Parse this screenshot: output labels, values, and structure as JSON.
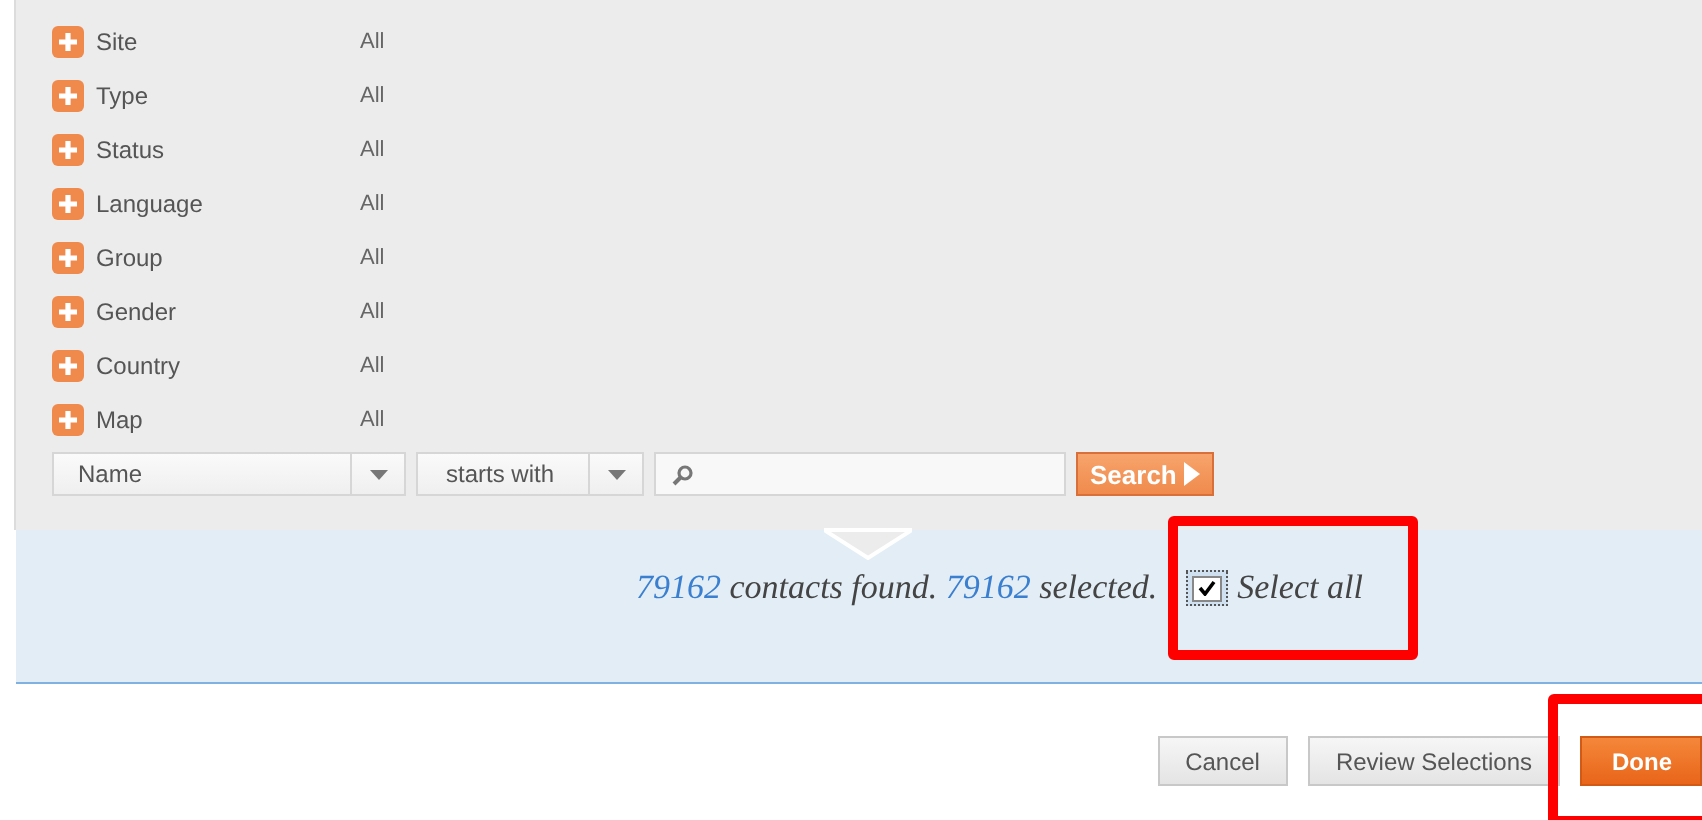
{
  "filters": [
    {
      "label": "Site",
      "value": "All"
    },
    {
      "label": "Type",
      "value": "All"
    },
    {
      "label": "Status",
      "value": "All"
    },
    {
      "label": "Language",
      "value": "All"
    },
    {
      "label": "Group",
      "value": "All"
    },
    {
      "label": "Gender",
      "value": "All"
    },
    {
      "label": "Country",
      "value": "All"
    },
    {
      "label": "Map",
      "value": "All"
    }
  ],
  "search_bar": {
    "field": "Name",
    "operator": "starts with",
    "button": "Search"
  },
  "results": {
    "found_count": "79162",
    "found_text": "contacts found.",
    "selected_count": "79162",
    "selected_text": "selected.",
    "select_all": {
      "label": "Select all",
      "checked": true,
      "highlighted": true
    }
  },
  "buttons": [
    {
      "label": "Cancel",
      "kind": "secondary",
      "highlighted": false
    },
    {
      "label": "Review Selections",
      "kind": "secondary",
      "highlighted": false
    },
    {
      "label": "Done",
      "kind": "primary",
      "highlighted": true
    }
  ]
}
